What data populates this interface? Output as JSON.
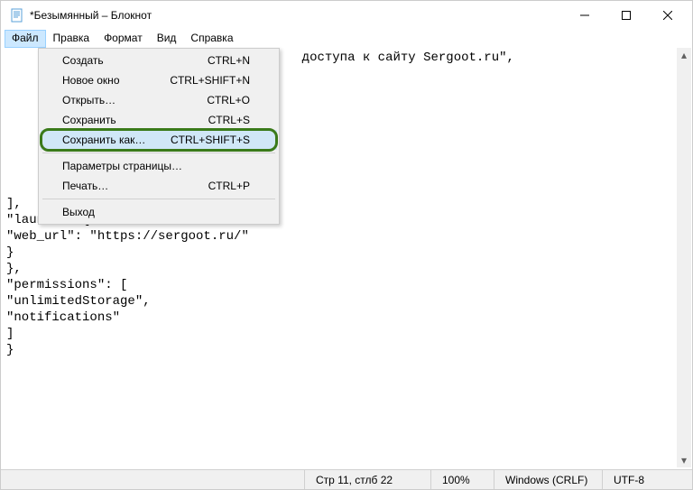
{
  "titlebar": {
    "title": "*Безымянный – Блокнот"
  },
  "menubar": {
    "file": "Файл",
    "edit": "Правка",
    "format": "Формат",
    "view": "Вид",
    "help": "Справка"
  },
  "file_menu": {
    "new": {
      "label": "Создать",
      "shortcut": "CTRL+N"
    },
    "new_window": {
      "label": "Новое окно",
      "shortcut": "CTRL+SHIFT+N"
    },
    "open": {
      "label": "Открыть…",
      "shortcut": "CTRL+O"
    },
    "save": {
      "label": "Сохранить",
      "shortcut": "CTRL+S"
    },
    "save_as": {
      "label": "Сохранить как…",
      "shortcut": "CTRL+SHIFT+S"
    },
    "page_setup": {
      "label": "Параметры страницы…",
      "shortcut": ""
    },
    "print": {
      "label": "Печать…",
      "shortcut": "CTRL+P"
    },
    "exit": {
      "label": "Выход",
      "shortcut": ""
    }
  },
  "editor": {
    "visible_line_fragment": " доступа к сайту Sergoot.ru\",",
    "lines_after": "],\n\"launch\": {\n\"web_url\": \"https://sergoot.ru/\"\n}\n},\n\"permissions\": [\n\"unlimitedStorage\",\n\"notifications\"\n]\n}"
  },
  "statusbar": {
    "position": "Стр 11, стлб 22",
    "zoom": "100%",
    "eol": "Windows (CRLF)",
    "encoding": "UTF-8"
  }
}
